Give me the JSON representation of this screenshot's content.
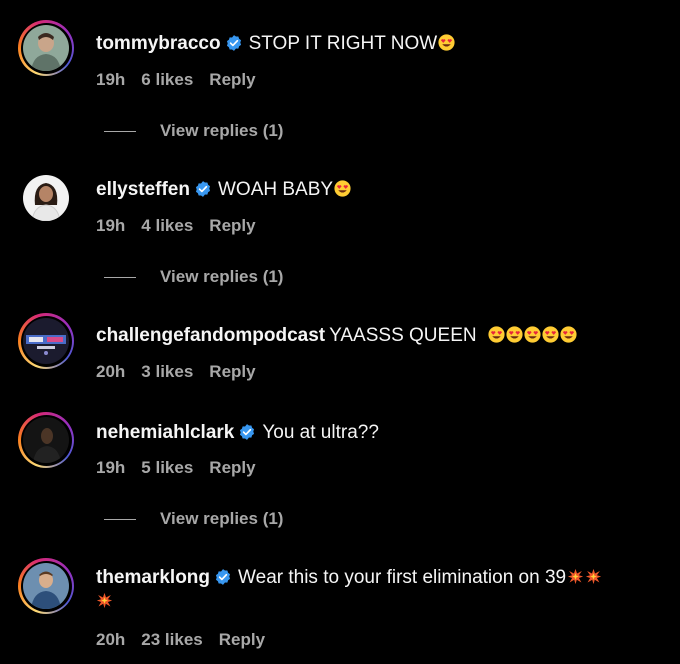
{
  "comments": [
    {
      "username": "tommybracco",
      "verified": true,
      "text": "STOP IT RIGHT NOW",
      "emojis": [
        "heart-eyes"
      ],
      "time": "19h",
      "likes": "6 likes",
      "reply": "Reply",
      "view_replies": "View replies (1)"
    },
    {
      "username": "ellysteffen",
      "verified": true,
      "text": "WOAH BABY",
      "emojis": [
        "heart-eyes"
      ],
      "time": "19h",
      "likes": "4 likes",
      "reply": "Reply",
      "view_replies": "View replies (1)"
    },
    {
      "username": "challengefandompodcast",
      "verified": false,
      "text": "YAASSS QUEEN",
      "emojis": [
        "heart-eyes",
        "heart-eyes",
        "heart-eyes",
        "heart-eyes",
        "heart-eyes"
      ],
      "time": "20h",
      "likes": "3 likes",
      "reply": "Reply"
    },
    {
      "username": "nehemiahlclark",
      "verified": true,
      "text": "You at ultra??",
      "emojis": [],
      "time": "19h",
      "likes": "5 likes",
      "reply": "Reply",
      "view_replies": "View replies (1)"
    },
    {
      "username": "themarklong",
      "verified": true,
      "text": "Wear this to your first elimination on 39",
      "emojis": [
        "collision",
        "collision",
        "collision"
      ],
      "time": "20h",
      "likes": "23 likes",
      "reply": "Reply"
    }
  ],
  "colors": {
    "background": "#000000",
    "text": "#f5f5f5",
    "muted": "#a8a8a8",
    "verified": "#3897f0"
  }
}
